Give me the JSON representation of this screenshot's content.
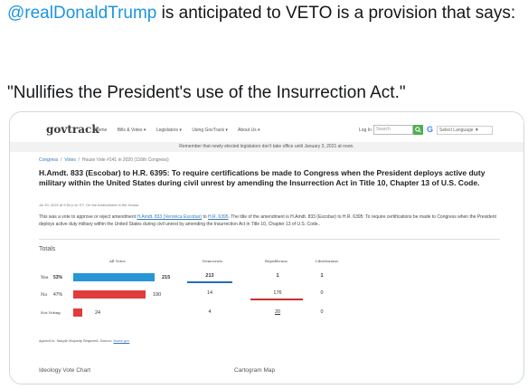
{
  "tweet": {
    "mention": "@realDonaldTrump",
    "text_after_mention": " is anticipated to VETO is a provision that says:",
    "quote": "\"Nullifies the President's use of the Insurrection Act.\""
  },
  "govtrack": {
    "topbar_text": "",
    "logo": "govtrack",
    "nav": [
      "Home",
      "Bills & Votes ▾",
      "Legislators ▾",
      "Using GovTrack ▾",
      "About Us ▾"
    ],
    "login": "Log In",
    "search_placeholder": "Search",
    "select_language": "Select Language ▼",
    "notice": "Remember that newly elected legislators don't take office until January 3, 2021 at noon.",
    "breadcrumbs": {
      "congress": "Congress",
      "votes": "Votes",
      "vote": "House Vote #141 in 2020 (116th Congress)"
    },
    "title": "H.Amdt. 833 (Escobar) to H.R. 6395: To require certifications be made to Congress when the President deploys active duty military within the United States during civil unrest by amending the Insurrection Act in Title 10, Chapter 13 of U.S. Code.",
    "date": "Jul 20, 2020 at 5:54 p.m. ET. On the Amendment in the House.",
    "description": {
      "part1": "This was a vote to approve or reject amendment ",
      "link1": "H.Amdt. 833 (Veronica Escobar)",
      "part2": " to ",
      "link2": "H.R. 6395",
      "part3": ". The title of the amendment is H.Amdt. 833 (Escobar) to H.R. 6395: To require certifications be made to Congress when the President deploys active duty military within the United States during civil unrest by amending the Insurrection Act in Title 10, Chapter 13 of U.S. Code.."
    },
    "totals_heading": "Totals",
    "columns": {
      "all": "All Votes",
      "dem": "Democrats",
      "rep": "Republicans",
      "lib": "Libertarians"
    },
    "rows": [
      {
        "label": "Yes",
        "pct": "53%",
        "total": "215",
        "dem": "213",
        "rep": "1",
        "lib": "1"
      },
      {
        "label": "No",
        "pct": "47%",
        "total": "190",
        "dem": "14",
        "rep": "176",
        "lib": "0"
      },
      {
        "label": "Not Voting",
        "pct": "",
        "total": "24",
        "dem": "4",
        "rep": "20",
        "lib": "0"
      }
    ],
    "bar_fraction": {
      "yes": 0.53,
      "no": 0.47,
      "not_voting": 0.06
    },
    "agreed": "Agreed to. Simple Majority Required. Source: ",
    "source_link": "house.gov",
    "section_left": "Ideology Vote Chart",
    "section_right": "Cartogram Map",
    "colors": {
      "yes": "#2596d6",
      "no": "#e03c3c",
      "dem": "#2a6cb8",
      "rep": "#c93030"
    }
  }
}
